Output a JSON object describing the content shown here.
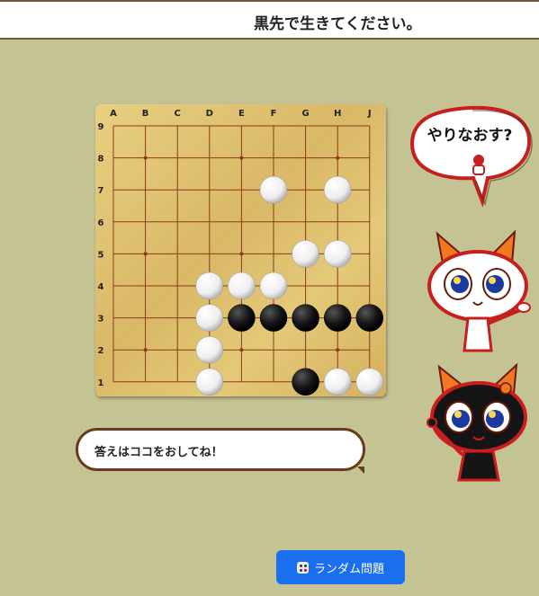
{
  "header": {
    "title": "黒先で生きてください。"
  },
  "board": {
    "columns": [
      "A",
      "B",
      "C",
      "D",
      "E",
      "F",
      "G",
      "H",
      "J"
    ],
    "rows": [
      "9",
      "8",
      "7",
      "6",
      "5",
      "4",
      "3",
      "2",
      "1"
    ],
    "stones": [
      {
        "color": "white",
        "point": "F7"
      },
      {
        "color": "white",
        "point": "H7"
      },
      {
        "color": "white",
        "point": "G5"
      },
      {
        "color": "white",
        "point": "H5"
      },
      {
        "color": "white",
        "point": "D4"
      },
      {
        "color": "white",
        "point": "E4"
      },
      {
        "color": "white",
        "point": "F4"
      },
      {
        "color": "white",
        "point": "D3"
      },
      {
        "color": "black",
        "point": "E3"
      },
      {
        "color": "black",
        "point": "F3"
      },
      {
        "color": "black",
        "point": "G3"
      },
      {
        "color": "black",
        "point": "H3"
      },
      {
        "color": "black",
        "point": "J3"
      },
      {
        "color": "white",
        "point": "D2"
      },
      {
        "color": "white",
        "point": "D1"
      },
      {
        "color": "black",
        "point": "G1"
      },
      {
        "color": "white",
        "point": "H1"
      },
      {
        "color": "white",
        "point": "J1"
      }
    ],
    "star_points": [
      "B8",
      "E8",
      "H8",
      "B5",
      "E5",
      "H5",
      "B2",
      "E2",
      "H2"
    ]
  },
  "retry_bubble": {
    "label": "やりなおす?"
  },
  "speech": {
    "text": "答えはココをおしてね！"
  },
  "random_button": {
    "label": "ランダム問題",
    "icon": "dice-icon",
    "color": "#1a6ff0"
  },
  "colors": {
    "background": "#c4c394",
    "board_line": "#8b3a1a",
    "speech_border": "#6b3a1a"
  }
}
